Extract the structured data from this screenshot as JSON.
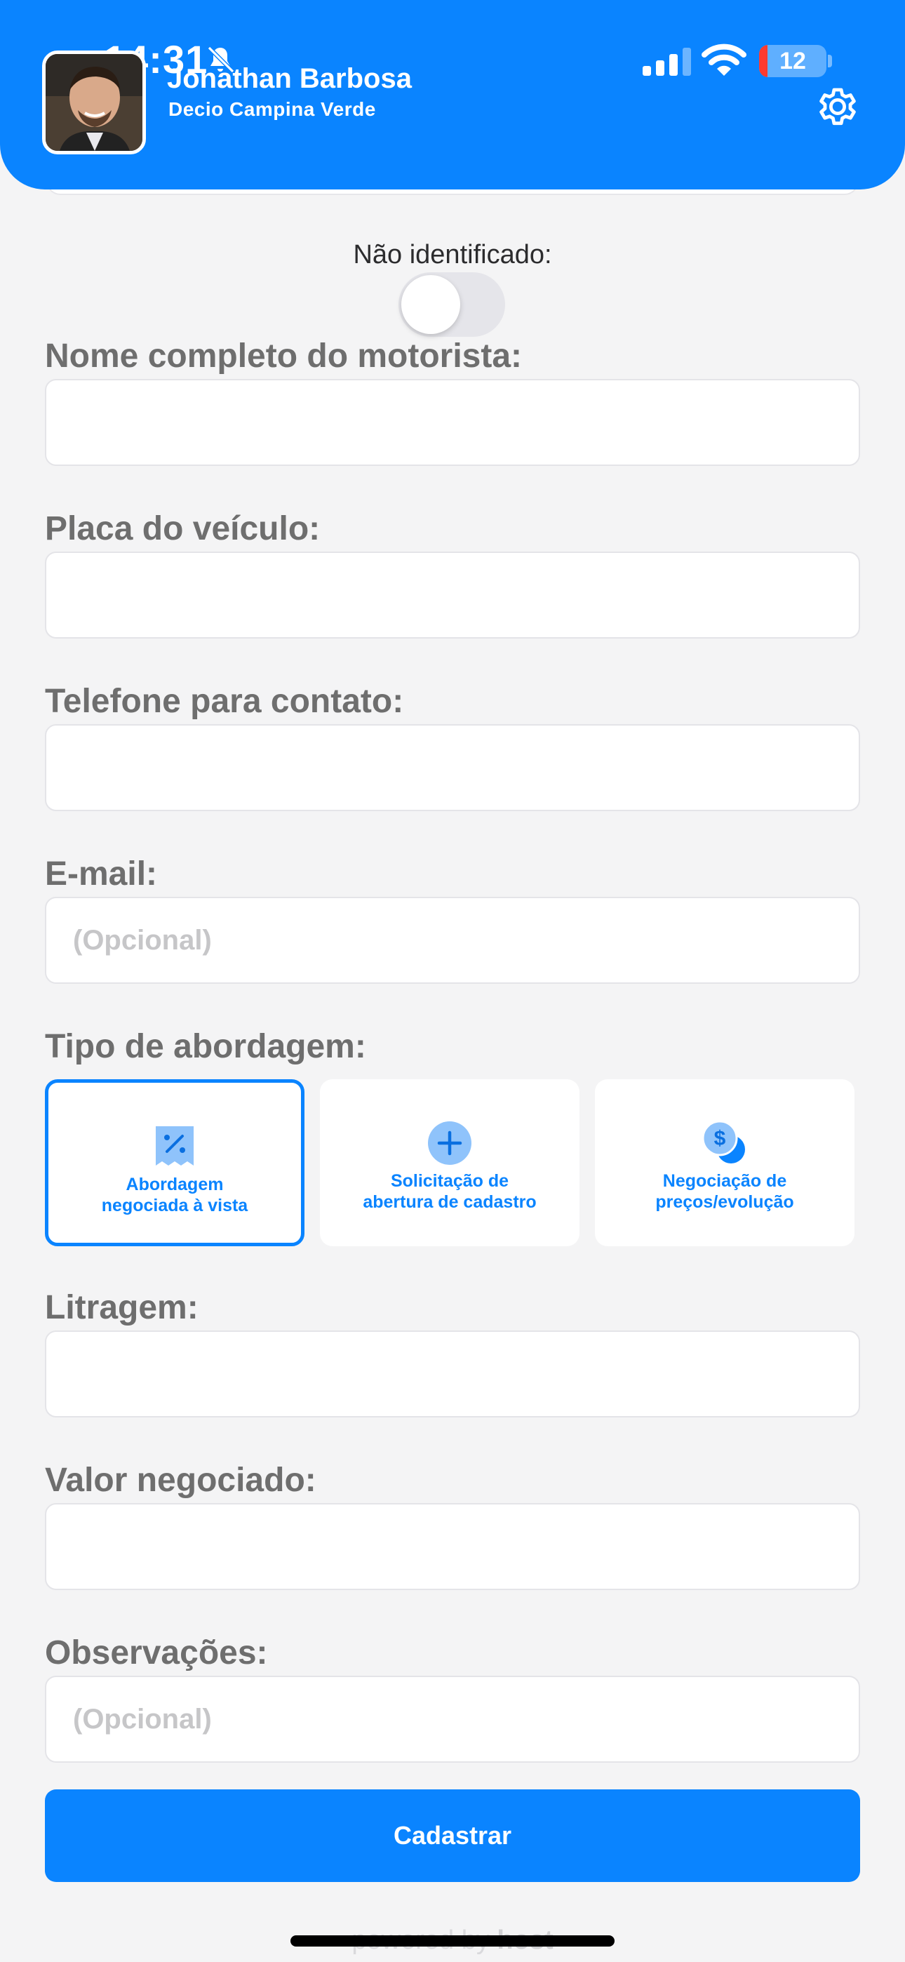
{
  "status_bar": {
    "time": "14:31",
    "battery": "12"
  },
  "header": {
    "user_name": "Jonathan Barbosa",
    "location": "Decio Campina Verde"
  },
  "toggle": {
    "label": "Não identificado:",
    "on": false
  },
  "fields": {
    "driver_name": {
      "label": "Nome completo do motorista:",
      "value": ""
    },
    "plate": {
      "label": "Placa do veículo:",
      "value": ""
    },
    "phone": {
      "label": "Telefone para contato:",
      "value": ""
    },
    "email": {
      "label": "E-mail:",
      "placeholder": "(Opcional)"
    },
    "litragem": {
      "label": "Litragem:",
      "value": ""
    },
    "valor": {
      "label": "Valor negociado:",
      "value": ""
    },
    "obs": {
      "label": "Observações:",
      "placeholder": "(Opcional)"
    }
  },
  "approach": {
    "label": "Tipo de abordagem:",
    "options": [
      {
        "line1": "Abordagem",
        "line2": "negociada à vista",
        "icon": "discount-ticket-icon",
        "selected": true
      },
      {
        "line1": "Solicitação de",
        "line2": "abertura de cadastro",
        "icon": "plus-circle-icon",
        "selected": false
      },
      {
        "line1": "Negociação de",
        "line2": "preços/evolução",
        "icon": "price-coins-icon",
        "selected": false
      }
    ]
  },
  "submit_label": "Cadastrar",
  "footer": {
    "powered_prefix": "powered by",
    "powered_brand": "host"
  },
  "colors": {
    "primary": "#0a84ff",
    "background": "#f4f4f5",
    "label": "#6e6e6e"
  }
}
